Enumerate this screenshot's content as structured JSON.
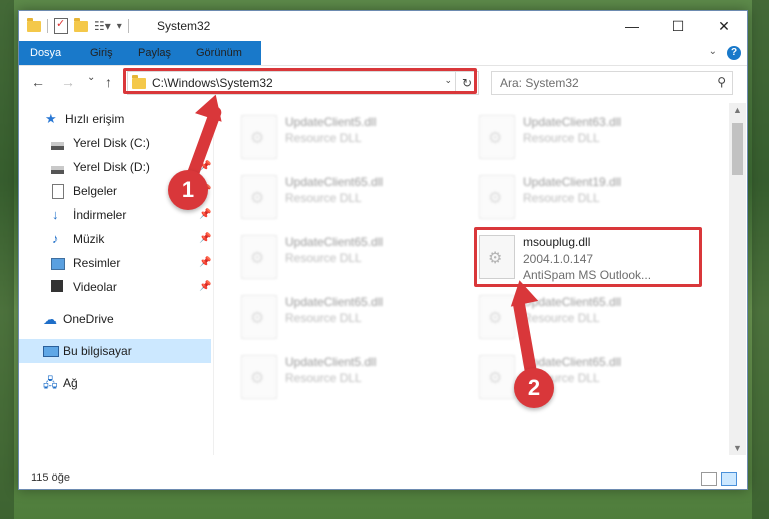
{
  "window": {
    "title": "System32",
    "minimize": "—",
    "maximize": "☐",
    "close": "✕"
  },
  "ribbon": {
    "tabs": [
      "Dosya",
      "Giriş",
      "Paylaş",
      "Görünüm"
    ],
    "help": "?"
  },
  "nav": {
    "back": "←",
    "forward": "→",
    "recent": "⌄",
    "up": "↑",
    "address": "C:\\Windows\\System32",
    "refresh": "↻",
    "search_placeholder": "Ara: System32"
  },
  "sidebar": {
    "items": [
      {
        "label": "Hızlı erişim",
        "icon": "star-icon"
      },
      {
        "label": "Yerel Disk (C:)",
        "icon": "disk-icon",
        "pinned": true
      },
      {
        "label": "Yerel Disk (D:)",
        "icon": "disk-icon",
        "pinned": true
      },
      {
        "label": "Belgeler",
        "icon": "document-icon",
        "pinned": true
      },
      {
        "label": "İndirmeler",
        "icon": "download-icon",
        "pinned": true
      },
      {
        "label": "Müzik",
        "icon": "music-icon",
        "pinned": true
      },
      {
        "label": "Resimler",
        "icon": "pictures-icon",
        "pinned": true
      },
      {
        "label": "Videolar",
        "icon": "videos-icon",
        "pinned": true
      },
      {
        "label": "OneDrive",
        "icon": "cloud-icon"
      },
      {
        "label": "Bu bilgisayar",
        "icon": "computer-icon",
        "selected": true
      },
      {
        "label": "Ağ",
        "icon": "network-icon"
      }
    ]
  },
  "files": [
    {
      "name": "UpdateClient5.dll",
      "desc": "Resource DLL"
    },
    {
      "name": "UpdateClient63.dll",
      "desc": "Resource DLL"
    },
    {
      "name": "UpdateClient65.dll",
      "desc": "Resource DLL"
    },
    {
      "name": "UpdateClient19.dll",
      "desc": "Resource DLL"
    },
    {
      "name": "UpdateClient65.dll",
      "desc": "Resource DLL"
    },
    {
      "name": "msouplug.dll",
      "version": "2004.1.0.147",
      "desc": "AntiSpam MS Outlook...",
      "highlighted": true
    },
    {
      "name": "UpdateClient65.dll",
      "desc": "Resource DLL"
    },
    {
      "name": "UpdateClient65.dll",
      "desc": "Resource DLL"
    },
    {
      "name": "UpdateClient5.dll",
      "desc": "Resource DLL"
    },
    {
      "name": "UpdateClient65.dll",
      "desc": "Resource DLL"
    }
  ],
  "status": {
    "item_count": "115 öğe"
  },
  "callouts": [
    "1",
    "2"
  ],
  "colors": {
    "accent": "#1979ca",
    "highlight": "#d9373a",
    "selected": "#cce8ff"
  }
}
